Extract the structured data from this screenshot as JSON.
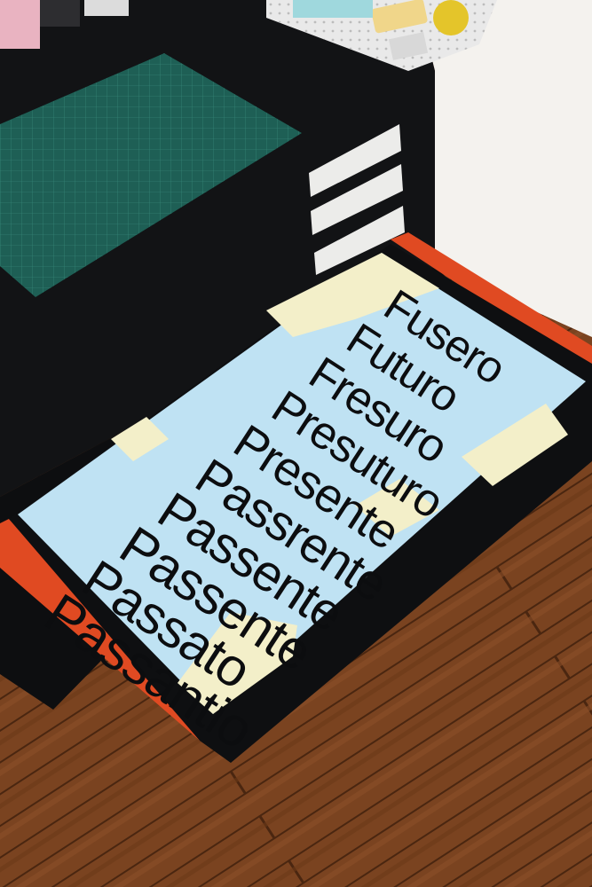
{
  "poster": {
    "lines": [
      "Fusero",
      "Futuro",
      "Fresuro",
      "Presuturo",
      "Presente",
      "Passrente",
      "Passente",
      "Passente",
      "Passato",
      "Passantio"
    ]
  },
  "colors": {
    "floor": "#7a4320",
    "cabinet": "#111214",
    "cutting_mat": "#1e5f55",
    "poster_blue": "#bfe2f3",
    "poster_cream": "#f3efc9",
    "drawer_rail": "#e04a22",
    "text": "#0c0d0f"
  },
  "icons": [
    "cutting-mat",
    "drawer-handle-labels",
    "pegboard-organizer",
    "yellow-glass"
  ]
}
